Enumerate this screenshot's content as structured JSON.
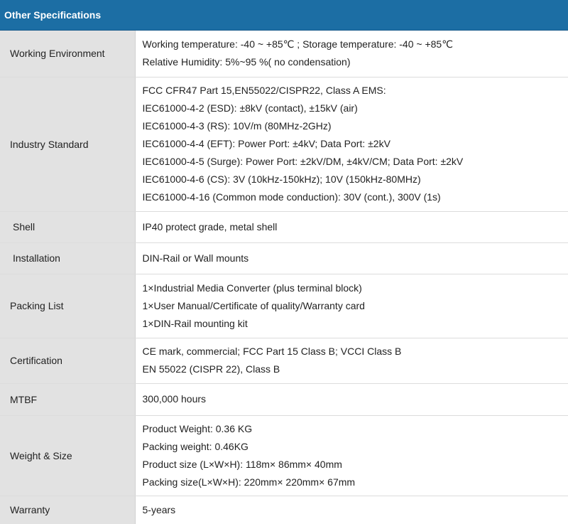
{
  "header": {
    "title": "Other Specifications"
  },
  "rows": [
    {
      "label": "Working Environment",
      "lines": [
        "Working temperature: -40 ~ +85℃ ;  Storage temperature: -40 ~ +85℃",
        "Relative Humidity: 5%~95 %( no condensation)"
      ]
    },
    {
      "label": "Industry Standard",
      "lines": [
        "FCC CFR47 Part 15,EN55022/CISPR22, Class A EMS:",
        "IEC61000-4-2 (ESD): ±8kV (contact), ±15kV (air)",
        "IEC61000-4-3 (RS): 10V/m (80MHz-2GHz)",
        "IEC61000-4-4 (EFT): Power Port: ±4kV; Data Port: ±2kV",
        "IEC61000-4-5 (Surge): Power Port: ±2kV/DM, ±4kV/CM; Data Port: ±2kV",
        "IEC61000-4-6 (CS): 3V (10kHz-150kHz); 10V (150kHz-80MHz)",
        "IEC61000-4-16 (Common mode conduction): 30V (cont.), 300V (1s)"
      ]
    },
    {
      "label": "Shell",
      "lines": [
        "IP40 protect grade, metal shell"
      ]
    },
    {
      "label": "Installation",
      "lines": [
        "DIN-Rail or Wall mounts"
      ]
    },
    {
      "label": "Packing List",
      "lines": [
        "1×Industrial Media Converter (plus terminal block)",
        "1×User Manual/Certificate of quality/Warranty card",
        "1×DIN-Rail mounting kit"
      ]
    },
    {
      "label": "Certification",
      "lines": [
        "CE mark, commercial; FCC Part 15 Class B; VCCI Class B",
        "EN 55022 (CISPR 22), Class B"
      ]
    },
    {
      "label": "MTBF",
      "lines": [
        "300,000 hours"
      ]
    },
    {
      "label": "Weight & Size",
      "lines": [
        "Product Weight: 0.36 KG",
        "Packing weight: 0.46KG",
        "Product size (L×W×H): 118m× 86mm× 40mm",
        "Packing size(L×W×H): 220mm× 220mm× 67mm"
      ]
    },
    {
      "label": "Warranty",
      "lines": [
        "5-years"
      ]
    }
  ]
}
